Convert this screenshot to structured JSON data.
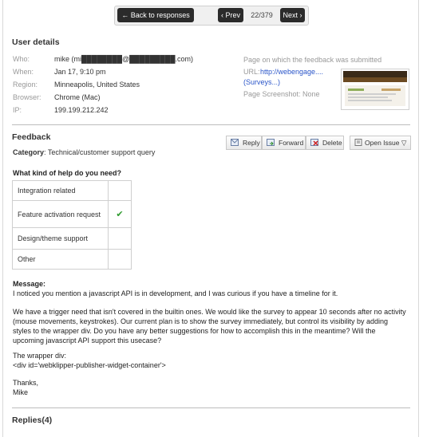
{
  "nav": {
    "back_label": "← Back to responses",
    "prev_label": "‹ Prev",
    "counter": "22/379",
    "next_label": "Next ›"
  },
  "user_details": {
    "title": "User details",
    "who_label": "Who:",
    "who_value": "mike (mi████████@█████████.com)",
    "when_label": "When:",
    "when_value": "Jan 17, 9:10 pm",
    "region_label": "Region:",
    "region_value": "Minneapolis, United States",
    "browser_label": "Browser:",
    "browser_value": "Chrome (Mac)",
    "ip_label": "IP:",
    "ip_value": "199.199.212.242"
  },
  "page_info": {
    "heading": "Page on which the feedback was submitted",
    "url_label": "URL:",
    "url_value": "http://webengage....",
    "url_title": "(Surveys...)",
    "screenshot_label": "Page Screenshot: None"
  },
  "feedback": {
    "title": "Feedback",
    "category_label": "Category",
    "category_value": ": Technical/customer support query",
    "actions": {
      "reply": "Reply",
      "forward": "Forward",
      "delete": "Delete",
      "open_issue": "Open Issue ▽"
    },
    "question": "What kind of help do you need?",
    "options": [
      {
        "label": "Integration related",
        "checked": ""
      },
      {
        "label": "Feature activation request",
        "checked": "✔"
      },
      {
        "label": "Design/theme support",
        "checked": ""
      },
      {
        "label": "Other",
        "checked": ""
      }
    ],
    "message_label": "Message:",
    "message_lines": [
      "I noticed you mention a javascript API is in development, and I was curious if you have a timeline for it.",
      "We have a trigger need that isn't covered in the builtin ones. We would like the survey to appear 10 seconds after no activity",
      "(mouse movements, keystrokes). Our current plan is to show the survey immediately, but control its visibility by adding",
      "styles to the wrapper div. Do you have any better suggestions for how to accomplish this in the meantime? Will the",
      "upcoming javascript API support this usecase?",
      "The wrapper div:",
      "<div id='webklipper-publisher-widget-container'>",
      "Thanks,",
      "Mike"
    ]
  },
  "replies": {
    "title": "Replies(4)"
  }
}
